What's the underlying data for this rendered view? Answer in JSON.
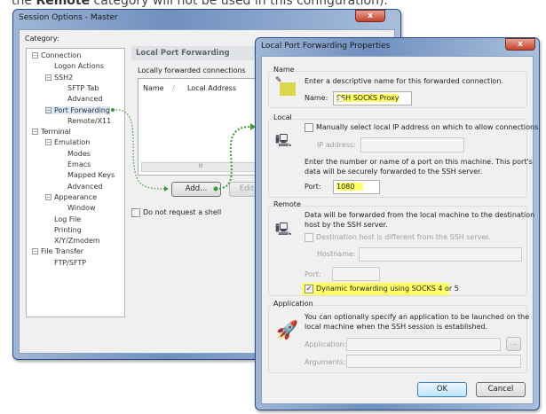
{
  "intro_text": {
    "prefix": "the ",
    "bold": "Remote",
    "suffix": " category will not be used in this configuration)."
  },
  "session_window": {
    "title": "Session Options - Master",
    "close_label": "x",
    "category_label": "Category:",
    "tree": [
      {
        "label": "Connection",
        "level": 0,
        "expander": "−"
      },
      {
        "label": "Logon Actions",
        "level": 1
      },
      {
        "label": "SSH2",
        "level": 1,
        "expander": "−"
      },
      {
        "label": "SFTP Tab",
        "level": 2
      },
      {
        "label": "Advanced",
        "level": 2
      },
      {
        "label": "Port Forwarding",
        "level": 1,
        "expander": "−",
        "selected": true
      },
      {
        "label": "Remote/X11",
        "level": 2
      },
      {
        "label": "Terminal",
        "level": 0,
        "expander": "−"
      },
      {
        "label": "Emulation",
        "level": 1,
        "expander": "−"
      },
      {
        "label": "Modes",
        "level": 2
      },
      {
        "label": "Emacs",
        "level": 2
      },
      {
        "label": "Mapped Keys",
        "level": 2
      },
      {
        "label": "Advanced",
        "level": 2
      },
      {
        "label": "Appearance",
        "level": 1,
        "expander": "−"
      },
      {
        "label": "Window",
        "level": 2
      },
      {
        "label": "Log File",
        "level": 1
      },
      {
        "label": "Printing",
        "level": 1
      },
      {
        "label": "X/Y/Zmodem",
        "level": 1
      },
      {
        "label": "File Transfer",
        "level": 0,
        "expander": "−"
      },
      {
        "label": "FTP/SFTP",
        "level": 1
      }
    ],
    "panel_header": "Local Port Forwarding",
    "list_label": "Locally forwarded connections",
    "columns": [
      "Name",
      "/",
      "Local Address"
    ],
    "scroll_thumb": "III",
    "add_button": "Add...",
    "edit_button": "Edit",
    "no_shell_label": "Do not request a shell"
  },
  "props_dialog": {
    "title": "Local Port Forwarding Properties",
    "close_label": "x",
    "name_group": {
      "title": "Name",
      "description": "Enter a descriptive name for this forwarded connection.",
      "name_label": "Name:",
      "name_value": "SSH SOCKS Proxy"
    },
    "local_group": {
      "title": "Local",
      "manual_ip_label": "Manually select local IP address on which to allow connections.",
      "ip_label": "IP address:",
      "ip_value": "",
      "description1": "Enter the number or name of a port on this machine.  This port's",
      "description2": "data will be securely forwarded to the SSH server.",
      "port_label": "Port:",
      "port_value": "1080"
    },
    "remote_group": {
      "title": "Remote",
      "description1": "Data will be forwarded from the local machine to the destination",
      "description2": "host by the SSH server.",
      "dest_label": "Destination host is different from the SSH server.",
      "hostname_label": "Hostname:",
      "port_label": "Port:",
      "dynamic_label": "Dynamic forwarding using SOCKS 4 or 5",
      "dynamic_checked": true
    },
    "application_group": {
      "title": "Application",
      "description1": "You can optionally specify an application to be launched on the",
      "description2": "local machine when the SSH session is established.",
      "application_label": "Application:",
      "browse_label": "...",
      "arguments_label": "Arguments:"
    },
    "ok_button": "OK",
    "cancel_button": "Cancel"
  },
  "colors": {
    "highlight": "#ffff66",
    "arrow": "#3a9a3a",
    "title_blue": "#6f8fbf"
  }
}
